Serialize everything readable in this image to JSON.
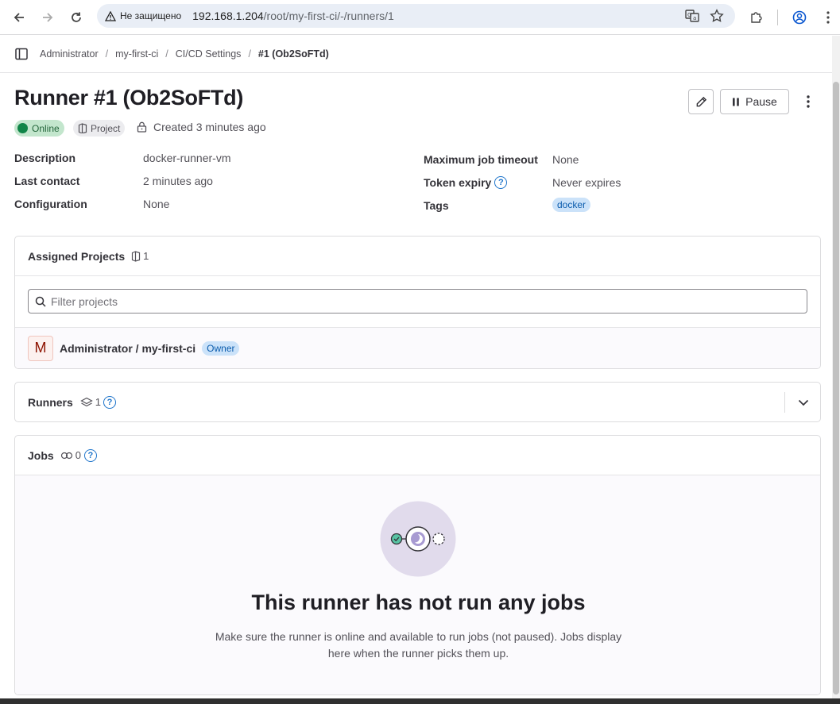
{
  "browser": {
    "security_label": "Не защищено",
    "url_host": "192.168.1.204",
    "url_path": "/root/my-first-ci/-/runners/1"
  },
  "breadcrumb": [
    "Administrator",
    "my-first-ci",
    "CI/CD Settings",
    "#1 (Ob2SoFTd)"
  ],
  "header": {
    "title": "Runner #1 (Ob2SoFTd)",
    "pause_label": "Pause",
    "status_label": "Online",
    "type_label": "Project",
    "created_text": "Created 3 minutes ago"
  },
  "details": {
    "left": [
      {
        "label": "Description",
        "value": "docker-runner-vm"
      },
      {
        "label": "Last contact",
        "value": "2 minutes ago"
      },
      {
        "label": "Configuration",
        "value": "None"
      }
    ],
    "right": [
      {
        "label": "Maximum job timeout",
        "value": "None"
      },
      {
        "label": "Token expiry",
        "value": "Never expires"
      },
      {
        "label": "Tags",
        "value": "docker"
      }
    ]
  },
  "assigned_projects": {
    "title": "Assigned Projects",
    "count": "1",
    "filter_placeholder": "Filter projects",
    "project_initial": "M",
    "project_name": "Administrator / my-first-ci",
    "project_role": "Owner"
  },
  "runners_section": {
    "title": "Runners",
    "count": "1"
  },
  "jobs_section": {
    "title": "Jobs",
    "count": "0",
    "empty_title": "This runner has not run any jobs",
    "empty_description": "Make sure the runner is online and available to run jobs (not paused). Jobs display here when the runner picks them up."
  },
  "colors": {
    "online": "#108548",
    "tag_bg": "#cbe2f9",
    "link": "#1f75cb"
  }
}
